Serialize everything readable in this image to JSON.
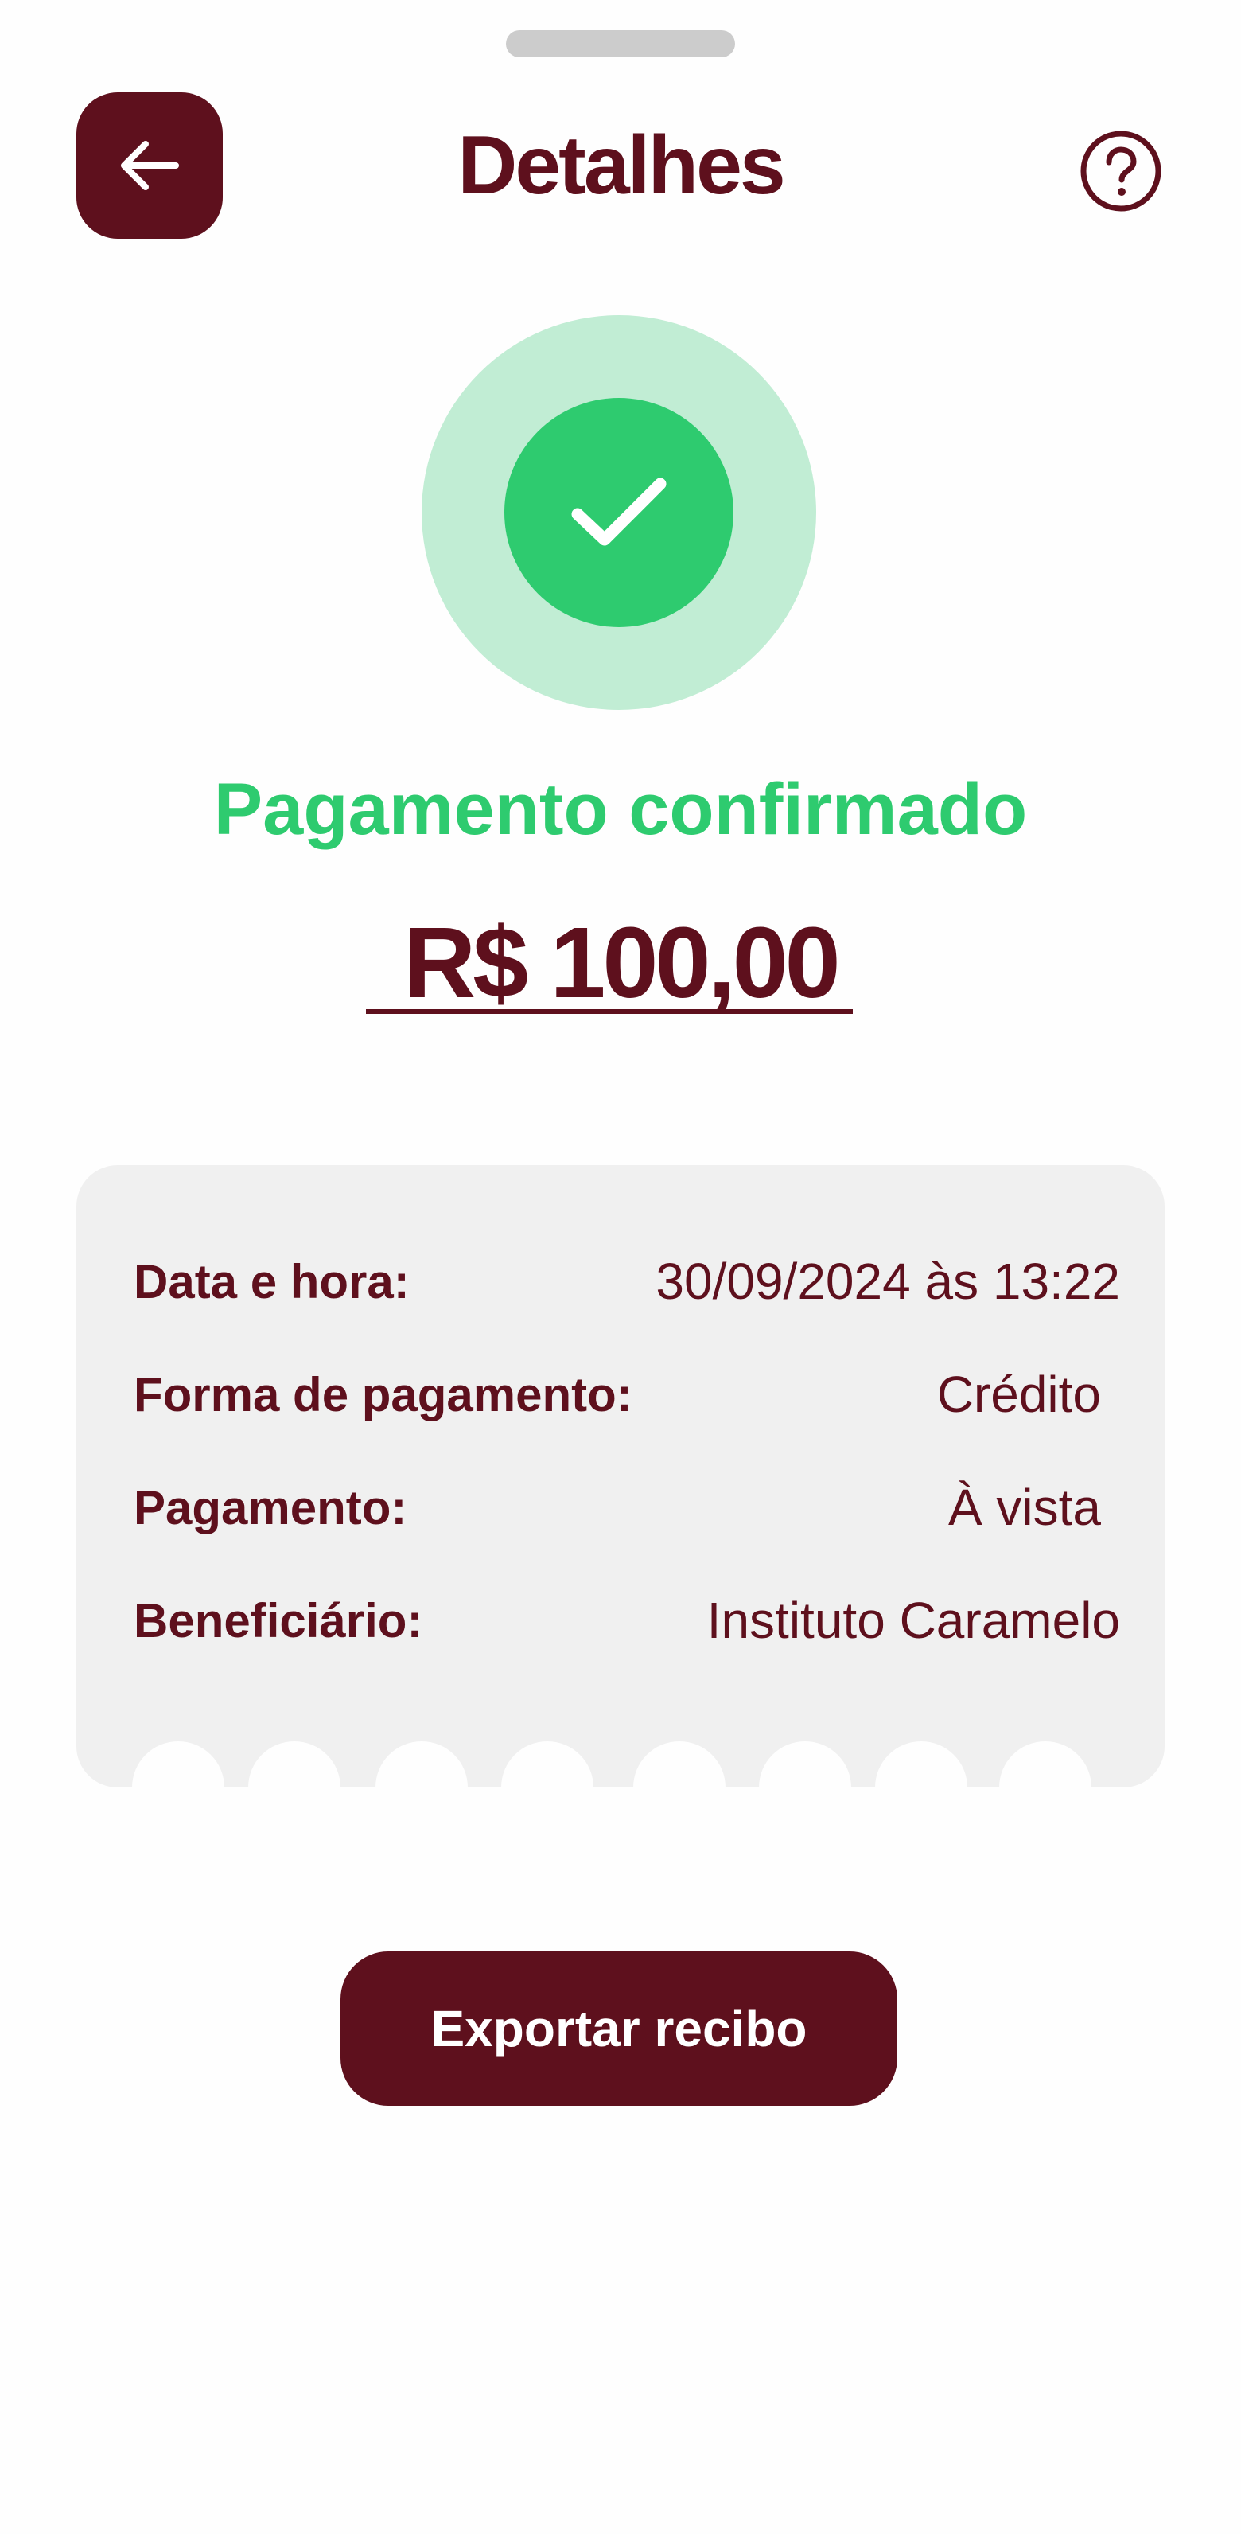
{
  "header": {
    "title": "Detalhes",
    "back_icon": "arrow-left-icon",
    "help_icon": "help-circle-icon"
  },
  "status": {
    "icon": "check-icon",
    "message": "Pagamento confirmado",
    "amount": "R$ 100,00"
  },
  "details": [
    {
      "label": "Data e hora:",
      "value": "30/09/2024 às 13:22"
    },
    {
      "label": "Forma de pagamento:",
      "value": "Crédito"
    },
    {
      "label": "Pagamento:",
      "value": "À vista"
    },
    {
      "label": "Beneficiário:",
      "value": "Instituto Caramelo"
    }
  ],
  "actions": {
    "export_label": "Exportar recibo"
  },
  "colors": {
    "brand": "#5e101d",
    "success": "#2ecb6f",
    "success_light": "#c1edd4",
    "card_background": "#f0f0f0",
    "grabber": "#cccccc"
  }
}
